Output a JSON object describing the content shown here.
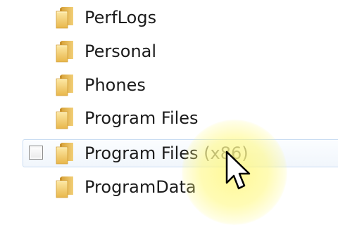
{
  "folders": [
    {
      "name": "PerfLogs",
      "suffix": ""
    },
    {
      "name": "Personal",
      "suffix": ""
    },
    {
      "name": "Phones",
      "suffix": ""
    },
    {
      "name": "Program Files",
      "suffix": ""
    },
    {
      "name": "Program Files ",
      "suffix": "(x86)"
    },
    {
      "name": "ProgramData",
      "suffix": ""
    }
  ],
  "icons": {
    "folder": "folder-icon",
    "checkbox": "checkbox",
    "cursor": "mouse-pointer-icon"
  },
  "colors": {
    "folder_yellow": "#f5d16a",
    "selection_border": "#c9dcf2",
    "highlight": "#fff878"
  }
}
